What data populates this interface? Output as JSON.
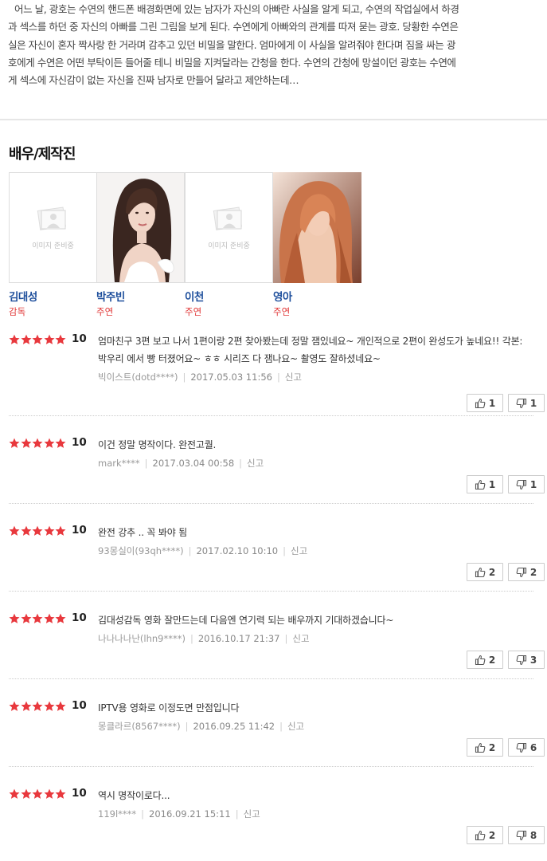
{
  "synopsis": {
    "lines": [
      "어느 날, 광호는 수연의 핸드폰 배경화면에 있는 남자가 자신의 아빠란 사실을 알게 되고, 수연의 작업실에서 하경",
      "과 섹스를 하던 중 자신의 아빠를 그린 그림을 보게 된다. 수연에게 아빠와의 관계를 따져 묻는 광호. 당황한 수연은",
      "실은 자신이 혼자 짝사랑 한 거라며 감추고 있던 비밀을 말한다. 엄마에게 이 사실을 알려줘야 한다며 짐을 싸는 광",
      "호에게 수연은 어떤 부탁이든 들어줄 테니 비밀을 지켜달라는 간청을 한다. 수연의 간청에 망설이던 광호는 수연에",
      "게 섹스에 자신감이 없는 자신을 진짜 남자로 만들어 달라고 제안하는데…"
    ]
  },
  "cast_section": {
    "title": "배우/제작진",
    "placeholder_text": "이미지 준비중",
    "members": [
      {
        "name": "김대성",
        "role": "감독",
        "has_photo": false
      },
      {
        "name": "박주빈",
        "role": "주연",
        "has_photo": true
      },
      {
        "name": "이천",
        "role": "주연",
        "has_photo": false
      },
      {
        "name": "영아",
        "role": "주연",
        "has_photo": true
      }
    ]
  },
  "report_label": "신고",
  "reviews": [
    {
      "stars": 5,
      "score": "10",
      "text": "엄마친구 3편 보고 나서 1편이랑 2편 찾아봤는데 정말 잼있네요~ 개인적으로 2편이 완성도가 높네요!! 각본: 박우리 에서 빵 터졌어요~ ㅎㅎ 시리즈 다 잼나요~ 촬영도 잘하셨네요~",
      "user": "빅이스트(dotd****)",
      "date": "2017.05.03 11:56",
      "likes": "1",
      "dislikes": "1"
    },
    {
      "stars": 5,
      "score": "10",
      "text": "이건 정말 명작이다. 완전고퀄.",
      "user": "mark****",
      "date": "2017.03.04 00:58",
      "likes": "1",
      "dislikes": "1"
    },
    {
      "stars": 5,
      "score": "10",
      "text": "완전 강추 .. 꼭 봐야 됨",
      "user": "93몽실이(93qh****)",
      "date": "2017.02.10 10:10",
      "likes": "2",
      "dislikes": "2"
    },
    {
      "stars": 5,
      "score": "10",
      "text": "김대성감독 영화 잘만드는데 다음엔 연기력 되는 배우까지 기대하겠습니다~",
      "user": "나나나나난(lhn9****)",
      "date": "2016.10.17 21:37",
      "likes": "2",
      "dislikes": "3"
    },
    {
      "stars": 5,
      "score": "10",
      "text": "IPTV용 영화로 이정도면 만점입니다",
      "user": "몽클라르(8567****)",
      "date": "2016.09.25 11:42",
      "likes": "2",
      "dislikes": "6"
    },
    {
      "stars": 5,
      "score": "10",
      "text": "역시 명작이로다...",
      "user": "119l****",
      "date": "2016.09.21 15:11",
      "likes": "2",
      "dislikes": "8"
    }
  ],
  "colors": {
    "star": "#e8383d",
    "cast_name": "#1e4f9c",
    "role": "#e03434"
  }
}
